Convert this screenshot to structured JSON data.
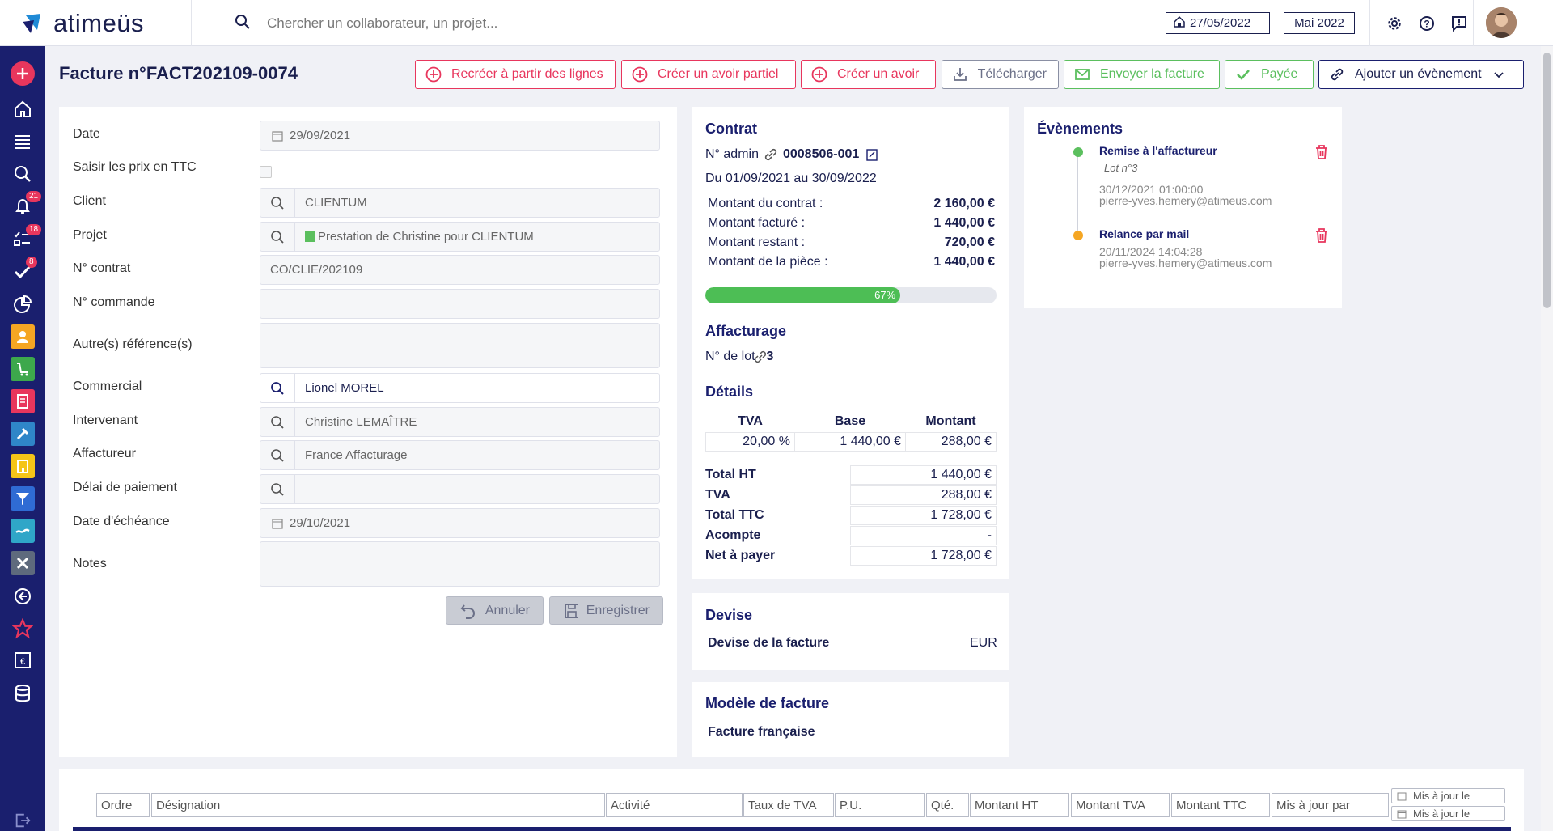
{
  "header": {
    "app_name": "atimeüs",
    "search_placeholder": "Chercher un collaborateur, un projet...",
    "date": "27/05/2022",
    "period": "Mai 2022"
  },
  "sidebar": {
    "badges": {
      "notifications": "21",
      "tasks": "18",
      "validations": "8"
    }
  },
  "page": {
    "title": "Facture n°FACT202109-0074"
  },
  "actions": {
    "recreate": "Recréer à partir des lignes",
    "partial_credit": "Créer un avoir partiel",
    "credit": "Créer un avoir",
    "download": "Télécharger",
    "send": "Envoyer la facture",
    "paid": "Payée",
    "add_event": "Ajouter un évènement"
  },
  "form": {
    "labels": {
      "date": "Date",
      "ttc": "Saisir les prix en TTC",
      "client": "Client",
      "project": "Projet",
      "contract": "N° contrat",
      "order": "N° commande",
      "other_refs": "Autre(s) référence(s)",
      "sales": "Commercial",
      "contributor": "Intervenant",
      "factor": "Affactureur",
      "payment_delay": "Délai de paiement",
      "due_date": "Date d'échéance",
      "notes": "Notes"
    },
    "values": {
      "date": "29/09/2021",
      "client": "CLIENTUM",
      "project": "Prestation de Christine pour CLIENTUM",
      "contract": "CO/CLIE/202109",
      "order": "",
      "other_refs": "",
      "sales": "Lionel MOREL",
      "contributor": "Christine LEMAÎTRE",
      "factor": "France Affacturage",
      "payment_delay": "",
      "due_date": "29/10/2021",
      "notes": ""
    },
    "cancel": "Annuler",
    "save": "Enregistrer"
  },
  "contract": {
    "title": "Contrat",
    "admin_label": "N° admin",
    "admin_value": "0008506-001",
    "period": "Du 01/09/2021 au 30/09/2022",
    "rows": [
      {
        "label": "Montant du contrat :",
        "value": "2 160,00 €"
      },
      {
        "label": "Montant facturé :",
        "value": "1 440,00 €"
      },
      {
        "label": "Montant restant :",
        "value": "720,00 €"
      },
      {
        "label": "Montant de la pièce :",
        "value": "1 440,00 €"
      }
    ],
    "progress_label": "67%",
    "progress": 0.67
  },
  "factoring": {
    "title": "Affacturage",
    "lot_label": "N° de lot",
    "lot_value": "3"
  },
  "details": {
    "title": "Détails",
    "headers": [
      "TVA",
      "Base",
      "Montant"
    ],
    "row": [
      "20,00 %",
      "1 440,00 €",
      "288,00 €"
    ],
    "totals": [
      {
        "label": "Total HT",
        "value": "1 440,00 €"
      },
      {
        "label": "TVA",
        "value": "288,00 €"
      },
      {
        "label": "Total TTC",
        "value": "1 728,00 €"
      },
      {
        "label": "Acompte",
        "value": "-"
      },
      {
        "label": "Net à payer",
        "value": "1 728,00 €"
      }
    ]
  },
  "currency": {
    "title": "Devise",
    "label": "Devise de la facture",
    "value": "EUR"
  },
  "template": {
    "title": "Modèle de facture",
    "value": "Facture française"
  },
  "events": {
    "title": "Évènements",
    "items": [
      {
        "title": "Remise à l'affactureur",
        "sub": "Lot n°3",
        "date": "30/12/2021 01:00:00",
        "user": "pierre-yves.hemery@atimeus.com",
        "color": "#5bbf5e"
      },
      {
        "title": "Relance par mail",
        "sub": "",
        "date": "20/11/2024 14:04:28",
        "user": "pierre-yves.hemery@atimeus.com",
        "color": "#f5a623"
      }
    ]
  },
  "lines": {
    "columns": [
      "Ordre",
      "Désignation",
      "Activité",
      "Taux de TVA",
      "P.U.",
      "Qté.",
      "Montant HT",
      "Montant TVA",
      "Montant TTC",
      "Mis à jour par"
    ],
    "updated_on": "Mis à jour le"
  }
}
